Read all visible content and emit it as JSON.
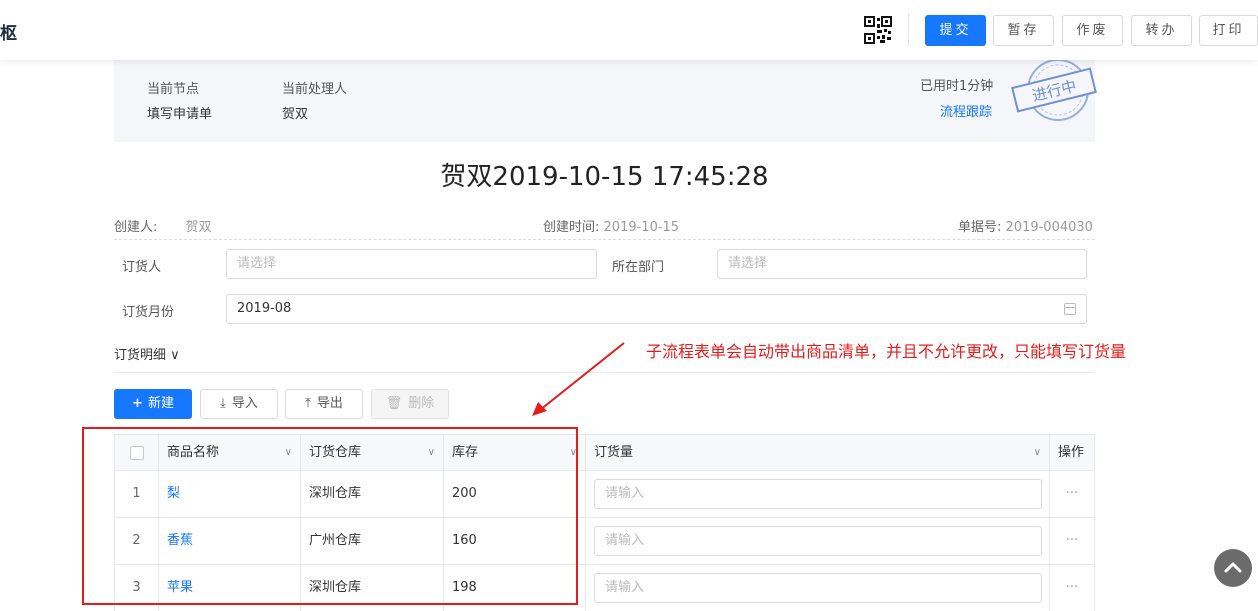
{
  "topbar": {
    "brand": "枢",
    "buttons": {
      "submit": "提交",
      "save_draft": "暂存",
      "void": "作废",
      "transfer": "转办",
      "print": "打印"
    }
  },
  "status": {
    "node_label": "当前节点",
    "node_value": "填写申请单",
    "handler_label": "当前处理人",
    "handler_value": "贺双",
    "elapsed": "已用时1分钟",
    "trace_link": "流程跟踪",
    "stamp_text": "进行中"
  },
  "doc": {
    "title": "贺双2019-10-15 17:45:28",
    "creator_label": "创建人:",
    "creator_value": "贺双",
    "created_label": "创建时间:",
    "created_value": "2019-10-15",
    "doc_no_label": "单据号:",
    "doc_no_value": "2019-004030"
  },
  "form": {
    "orderer_label": "订货人",
    "orderer_placeholder": "请选择",
    "dept_label": "所在部门",
    "dept_placeholder": "请选择",
    "month_label": "订货月份",
    "month_value": "2019-08"
  },
  "detail": {
    "section_label": "订货明细 ∨",
    "actions": {
      "new": "新建",
      "import": "导入",
      "export": "导出",
      "delete": "删除"
    },
    "annotation": "子流程表单会自动带出商品清单，并且不允许更改，只能填写订货量",
    "columns": {
      "name": "商品名称",
      "warehouse": "订货仓库",
      "stock": "库存",
      "qty": "订货量",
      "ops": "操作"
    },
    "rows": [
      {
        "index": "1",
        "name": "梨",
        "warehouse": "深圳仓库",
        "stock": "200",
        "qty_placeholder": "请输入",
        "ops": "···"
      },
      {
        "index": "2",
        "name": "香蕉",
        "warehouse": "广州仓库",
        "stock": "160",
        "qty_placeholder": "请输入",
        "ops": "···"
      },
      {
        "index": "3",
        "name": "苹果",
        "warehouse": "深圳仓库",
        "stock": "198",
        "qty_placeholder": "请输入",
        "ops": "···"
      }
    ]
  },
  "colors": {
    "primary": "#1677ff",
    "annotation_red": "#e51c1c",
    "status_bg": "#f4f6fa"
  },
  "icons": [
    "qr-code-icon",
    "plus-icon",
    "download-icon",
    "upload-icon",
    "trash-icon",
    "calendar-icon",
    "chevron-down-icon",
    "arrow-up-icon",
    "stamp-icon"
  ]
}
